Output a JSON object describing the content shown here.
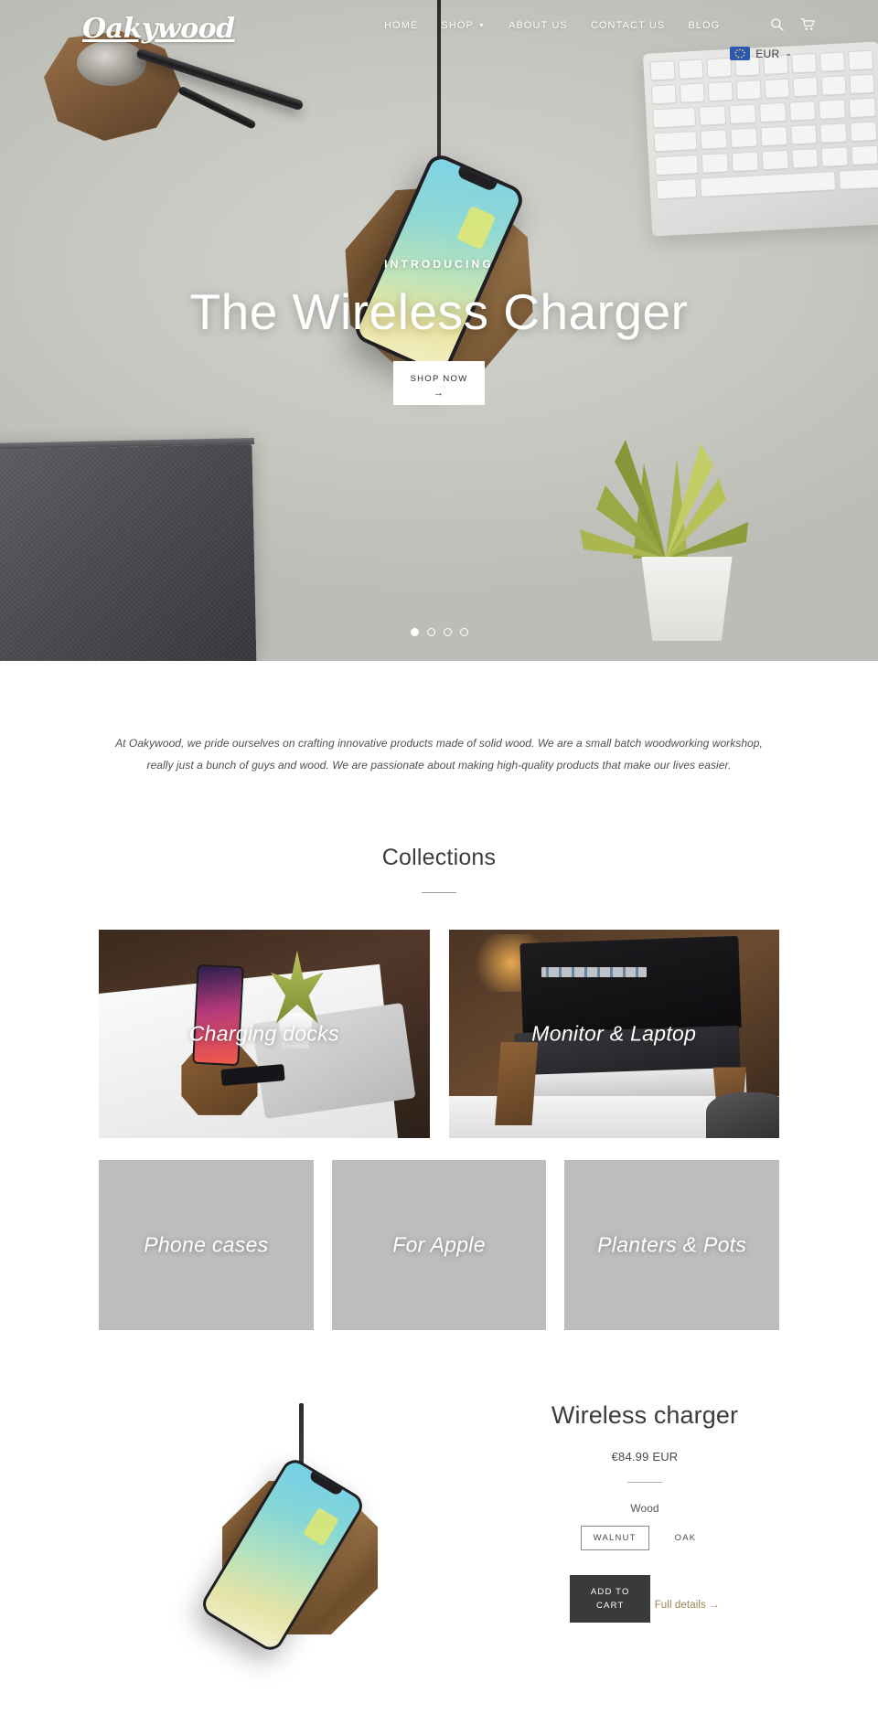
{
  "site": {
    "brand": "Oakywood",
    "accent_gold": "#9a8254",
    "dark_button": "#3a3a3a"
  },
  "header": {
    "nav": [
      {
        "label": "HOME",
        "has_dropdown": false
      },
      {
        "label": "SHOP",
        "has_dropdown": true
      },
      {
        "label": "ABOUT US",
        "has_dropdown": false
      },
      {
        "label": "CONTACT US",
        "has_dropdown": false
      },
      {
        "label": "BLOG",
        "has_dropdown": false
      }
    ],
    "search_icon": "search-icon",
    "cart_icon": "shopping-cart-icon",
    "currency": {
      "code": "EUR",
      "flag": "european-union-flag",
      "caret": "⌄"
    }
  },
  "hero": {
    "eyebrow": "INTRODUCING",
    "title": "The Wireless Charger",
    "cta_label": "SHOP NOW",
    "cta_arrow": "→",
    "slides_total": 4,
    "active_slide": 1
  },
  "intro": {
    "paragraph": "At Oakywood, we pride ourselves on crafting innovative products made of solid wood. We are a small batch woodworking workshop, really just a bunch of guys and wood. We are passionate about making high-quality products that make our lives easier."
  },
  "collections": {
    "title": "Collections",
    "featured": [
      {
        "label": "Charging docks"
      },
      {
        "label": "Monitor & Laptop"
      }
    ],
    "secondary": [
      {
        "label": "Phone cases"
      },
      {
        "label": "For Apple"
      },
      {
        "label": "Planters & Pots"
      }
    ]
  },
  "product": {
    "title": "Wireless charger",
    "price": "€84.99 EUR",
    "option_label": "Wood",
    "options": [
      {
        "label": "WALNUT",
        "selected": true
      },
      {
        "label": "OAK",
        "selected": false
      }
    ],
    "add_to_cart_line1": "ADD TO",
    "add_to_cart_line2": "CART",
    "full_details_label": "Full details →"
  }
}
